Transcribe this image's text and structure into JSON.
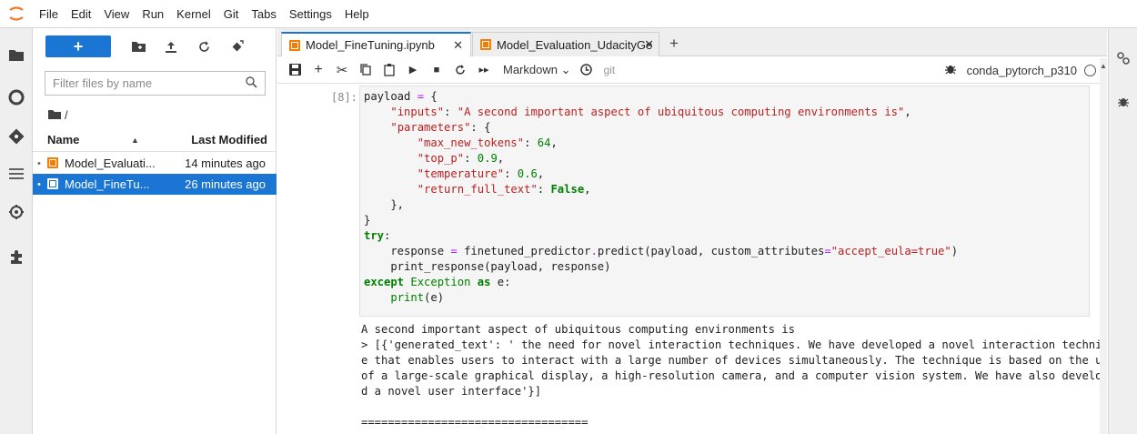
{
  "menu": [
    "File",
    "Edit",
    "View",
    "Run",
    "Kernel",
    "Git",
    "Tabs",
    "Settings",
    "Help"
  ],
  "filebrowser": {
    "new_label": "+",
    "filter_placeholder": "Filter files by name",
    "breadcrumb": "/",
    "col_name": "Name",
    "col_modified": "Last Modified",
    "files": [
      {
        "name": "Model_Evaluati...",
        "modified": "14 minutes ago",
        "selected": false
      },
      {
        "name": "Model_FineTu...",
        "modified": "26 minutes ago",
        "selected": true
      }
    ]
  },
  "tabs": [
    {
      "title": "Model_FineTuning.ipynb",
      "active": true
    },
    {
      "title": "Model_Evaluation_UdacityGe",
      "active": false
    }
  ],
  "toolbar": {
    "cell_type": "Markdown",
    "git_label": "git",
    "kernel": "conda_pytorch_p310"
  },
  "cell": {
    "prompt": "[8]:",
    "output_lines": [
      "A second important aspect of ubiquitous computing environments is",
      "> [{'generated_text': ' the need for novel interaction techniques. We have developed a novel interaction techniqu",
      "e that enables users to interact with a large number of devices simultaneously. The technique is based on the use",
      "of a large-scale graphical display, a high-resolution camera, and a computer vision system. We have also develope",
      "d a novel user interface'}]",
      "",
      "=================================="
    ]
  },
  "colors": {
    "accent": "#1a76d2",
    "notebook_icon": "#f57c00"
  }
}
